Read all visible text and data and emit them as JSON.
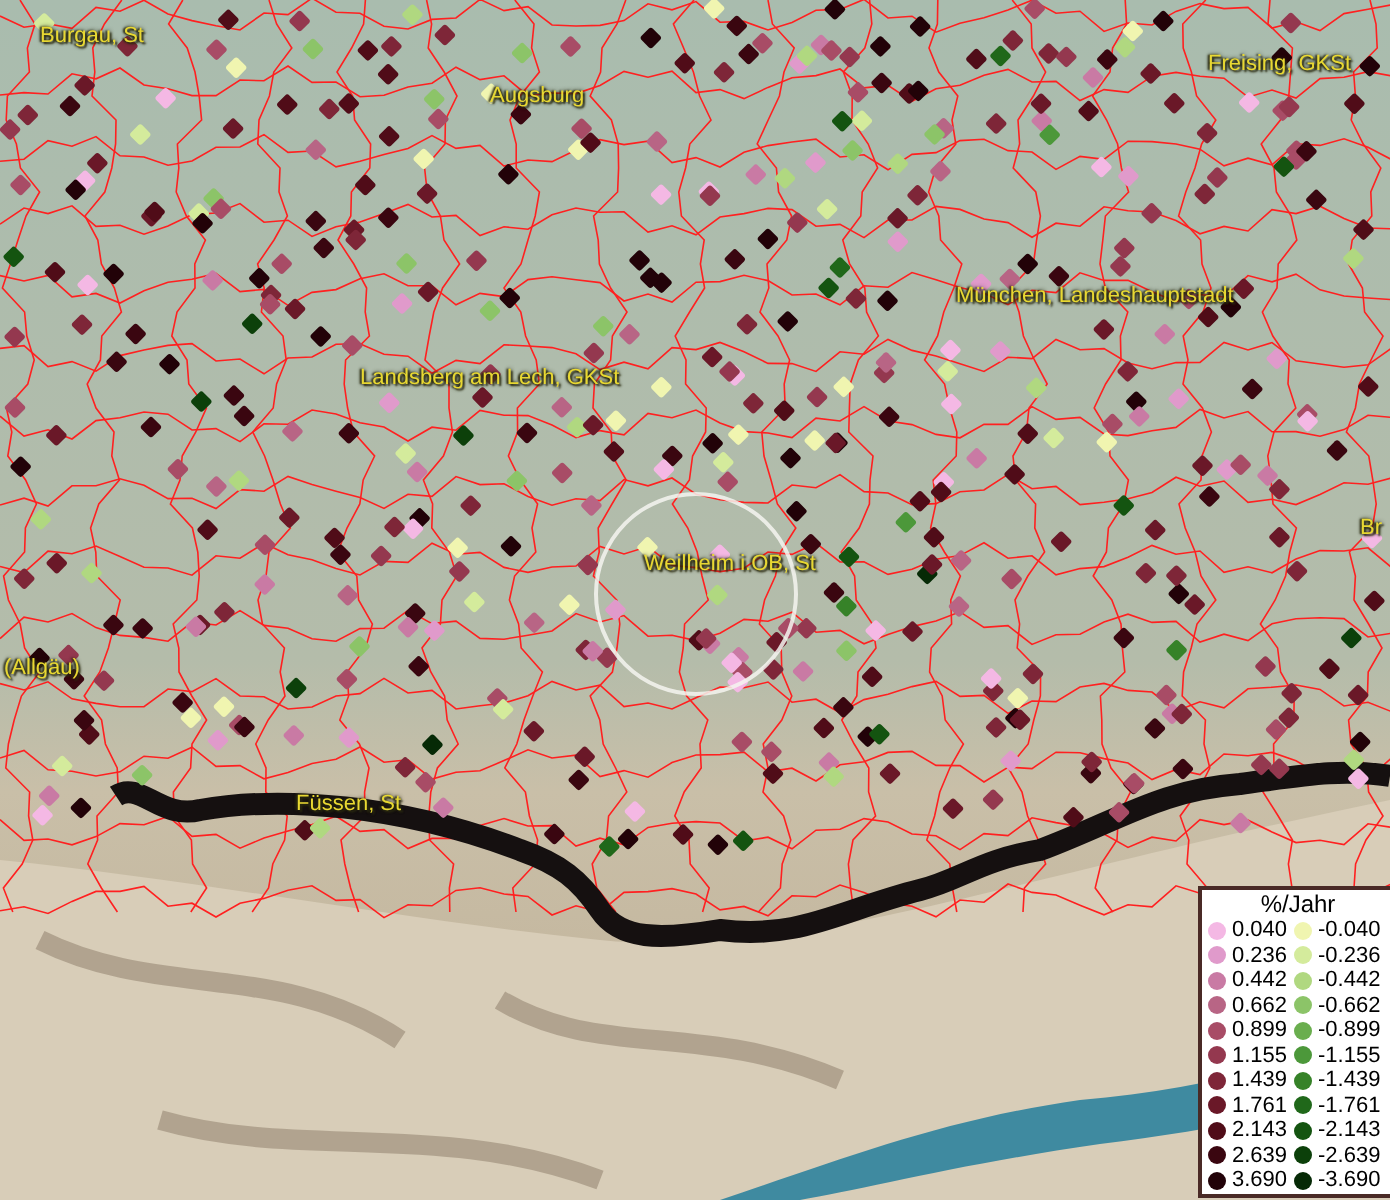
{
  "map": {
    "labels": [
      {
        "text": "Burgau, St"
      },
      {
        "text": "Augsburg"
      },
      {
        "text": "Freising, GKSt"
      },
      {
        "text": "München, Landeshauptstadt"
      },
      {
        "text": "Landsberg am Lech, GKSt"
      },
      {
        "text": "Br"
      },
      {
        "text": "Weilheim i.OB, St"
      },
      {
        "text": "(Allgäu)"
      },
      {
        "text": "Füssen, St"
      }
    ]
  },
  "legend": {
    "title": "%/Jahr",
    "items": [
      {
        "label": "0.040",
        "color": "#f4b8e4"
      },
      {
        "label": "-0.040",
        "color": "#f0f5b0"
      },
      {
        "label": "0.236",
        "color": "#e09acb"
      },
      {
        "label": "-0.236",
        "color": "#d4eb9c"
      },
      {
        "label": "0.442",
        "color": "#c97aa4"
      },
      {
        "label": "-0.442",
        "color": "#b0d880"
      },
      {
        "label": "0.662",
        "color": "#b86585"
      },
      {
        "label": "-0.662",
        "color": "#8cc468"
      },
      {
        "label": "0.899",
        "color": "#a84c66"
      },
      {
        "label": "-0.899",
        "color": "#6aae4e"
      },
      {
        "label": "1.155",
        "color": "#94384f"
      },
      {
        "label": "-1.155",
        "color": "#4c983a"
      },
      {
        "label": "1.439",
        "color": "#7e2638"
      },
      {
        "label": "-1.439",
        "color": "#368228"
      },
      {
        "label": "1.761",
        "color": "#6a1828"
      },
      {
        "label": "-1.761",
        "color": "#20681a"
      },
      {
        "label": "2.143",
        "color": "#500c18"
      },
      {
        "label": "-2.143",
        "color": "#145410"
      },
      {
        "label": "2.639",
        "color": "#3a0610"
      },
      {
        "label": "-2.639",
        "color": "#0c400a"
      },
      {
        "label": "3.690",
        "color": "#220208"
      },
      {
        "label": "-3.690",
        "color": "#062a06"
      }
    ]
  }
}
